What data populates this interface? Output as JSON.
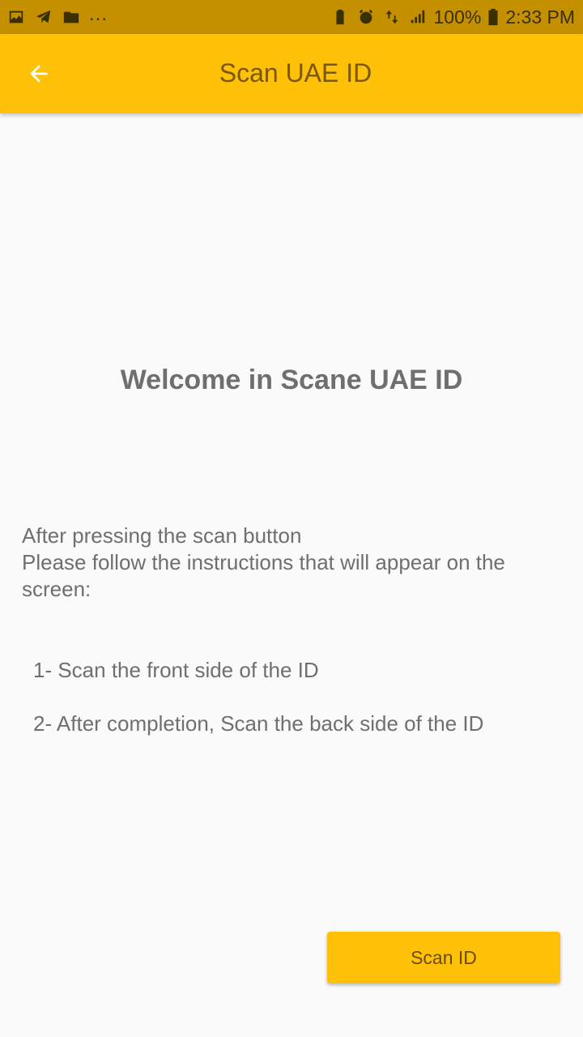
{
  "status_bar": {
    "left_icons": [
      "image-icon",
      "telegram-icon",
      "folder-icon"
    ],
    "more_indicator": "...",
    "right_icons": [
      "battery-saver-icon",
      "alarm-icon",
      "data-transfer-icon",
      "signal-icon"
    ],
    "battery_percent": "100%",
    "time": "2:33 PM"
  },
  "app_bar": {
    "back_icon": "arrow-back-icon",
    "title": "Scan UAE ID",
    "background_color": "#ffc107"
  },
  "main": {
    "welcome": "Welcome in Scane UAE ID",
    "intro_lines": [
      "After pressing the scan button",
      "Please follow the instructions that will appear on the screen:"
    ],
    "steps": [
      "1- Scan the front side of the ID",
      "2- After completion, Scan the back side of the ID"
    ]
  },
  "actions": {
    "scan_button_label": "Scan ID",
    "scan_button_color": "#ffc107"
  }
}
